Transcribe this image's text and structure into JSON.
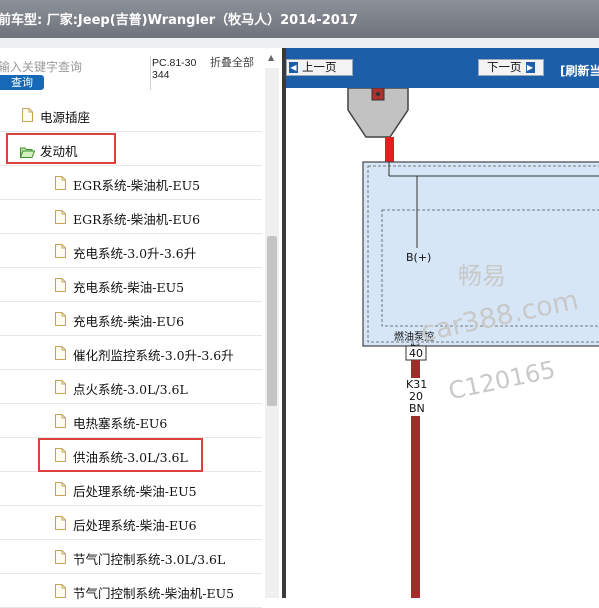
{
  "window": {
    "title": "前车型: 厂家:Jeep(吉普)Wrangler（牧马人）2014-2017"
  },
  "search": {
    "placeholder": "输入关键字查询",
    "button": "查询"
  },
  "pc_code": "PC.81-30344",
  "collapse_all": "折叠全部",
  "tree": {
    "items": [
      {
        "label": "电源插座",
        "type": "doc"
      },
      {
        "label": "发动机",
        "type": "folder-open"
      },
      {
        "label": "EGR系统-柴油机-EU5",
        "type": "doc"
      },
      {
        "label": "EGR系统-柴油机-EU6",
        "type": "doc"
      },
      {
        "label": "充电系统-3.0升-3.6升",
        "type": "doc"
      },
      {
        "label": "充电系统-柴油-EU5",
        "type": "doc"
      },
      {
        "label": "充电系统-柴油-EU6",
        "type": "doc"
      },
      {
        "label": "催化剂监控系统-3.0升-3.6升",
        "type": "doc"
      },
      {
        "label": "点火系统-3.0L/3.6L",
        "type": "doc"
      },
      {
        "label": "电热塞系统-EU6",
        "type": "doc"
      },
      {
        "label": "供油系统-3.0L/3.6L",
        "type": "doc",
        "highlighted": true
      },
      {
        "label": "后处理系统-柴油-EU5",
        "type": "doc"
      },
      {
        "label": "后处理系统-柴油-EU6",
        "type": "doc"
      },
      {
        "label": "节气门控制系统-3.0L/3.6L",
        "type": "doc"
      },
      {
        "label": "节气门控制系统-柴油机-EU5",
        "type": "doc"
      }
    ]
  },
  "nav": {
    "prev": "上一页",
    "next": "下一页",
    "refresh": "[刷新当"
  },
  "diagram": {
    "pin_label": "B(+)",
    "module_label_line1": "燃油泵控",
    "module_label_line2": "制",
    "pin_number": "40",
    "wire_code": "K31",
    "wire_gauge": "20",
    "wire_color": "BN"
  },
  "watermark": {
    "line1": "畅易",
    "line2": "car388.com",
    "line3": "C120165"
  },
  "colors": {
    "nav_blue": "#1d5ea8",
    "highlight_red": "#e0403c",
    "wire_red": "#a52a2a",
    "module_fill": "#d6e6f6"
  }
}
